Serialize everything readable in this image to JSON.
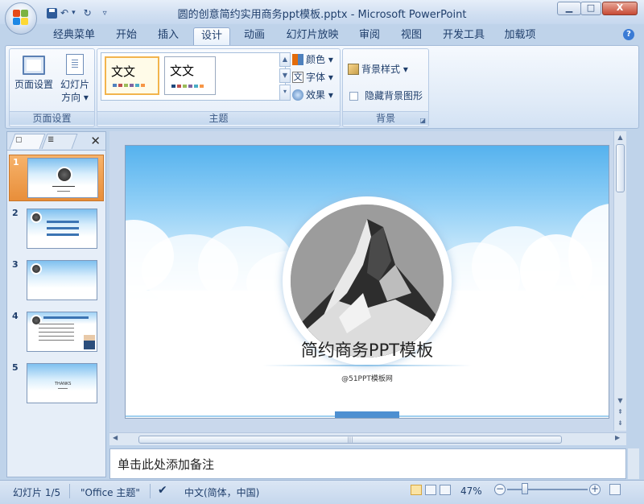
{
  "window": {
    "title": "圆的创意简约实用商务ppt模板.pptx - Microsoft PowerPoint",
    "min_label": "▁",
    "max_label": "□",
    "close_label": "X"
  },
  "qat": {
    "undo": "↶",
    "dropdown": "▾",
    "redo": "↻",
    "customize": "▿"
  },
  "tabs": [
    {
      "label": "经典菜单"
    },
    {
      "label": "开始"
    },
    {
      "label": "插入"
    },
    {
      "label": "设计",
      "active": true
    },
    {
      "label": "动画"
    },
    {
      "label": "幻灯片放映"
    },
    {
      "label": "审阅"
    },
    {
      "label": "视图"
    },
    {
      "label": "开发工具"
    },
    {
      "label": "加载项"
    }
  ],
  "help_label": "?",
  "ribbon": {
    "page_setup": {
      "page_setup_label": "页面设置",
      "orientation_label_1": "幻灯片",
      "orientation_label_2": "方向 ▾",
      "group_label": "页面设置"
    },
    "themes": {
      "thumb_text_1": "文文",
      "thumb_text_2": "文文",
      "colors_label": "颜色 ▾",
      "fonts_label": "字体 ▾",
      "effects_label": "效果 ▾",
      "fonts_icon_text": "文",
      "group_label": "主题"
    },
    "background": {
      "styles_label": "背景样式 ▾",
      "hide_graphics_label": "隐藏背景图形",
      "group_label": "背景"
    }
  },
  "slides": [
    {
      "num": "1",
      "selected": true
    },
    {
      "num": "2"
    },
    {
      "num": "3"
    },
    {
      "num": "4"
    },
    {
      "num": "5",
      "text": "THANKS"
    }
  ],
  "slide": {
    "title": "简约商务PPT模板",
    "subtitle": "@51PPT模板网"
  },
  "notes_placeholder": "单击此处添加备注",
  "status": {
    "slide_counter": "幻灯片 1/5",
    "theme": "\"Office 主题\"",
    "language": "中文(简体，中国)",
    "zoom": "47%"
  },
  "colors": {
    "accent": "#4d8fd1",
    "selected_thumb": "#e88e3a",
    "ribbon_bg": "#dfeaf7"
  }
}
